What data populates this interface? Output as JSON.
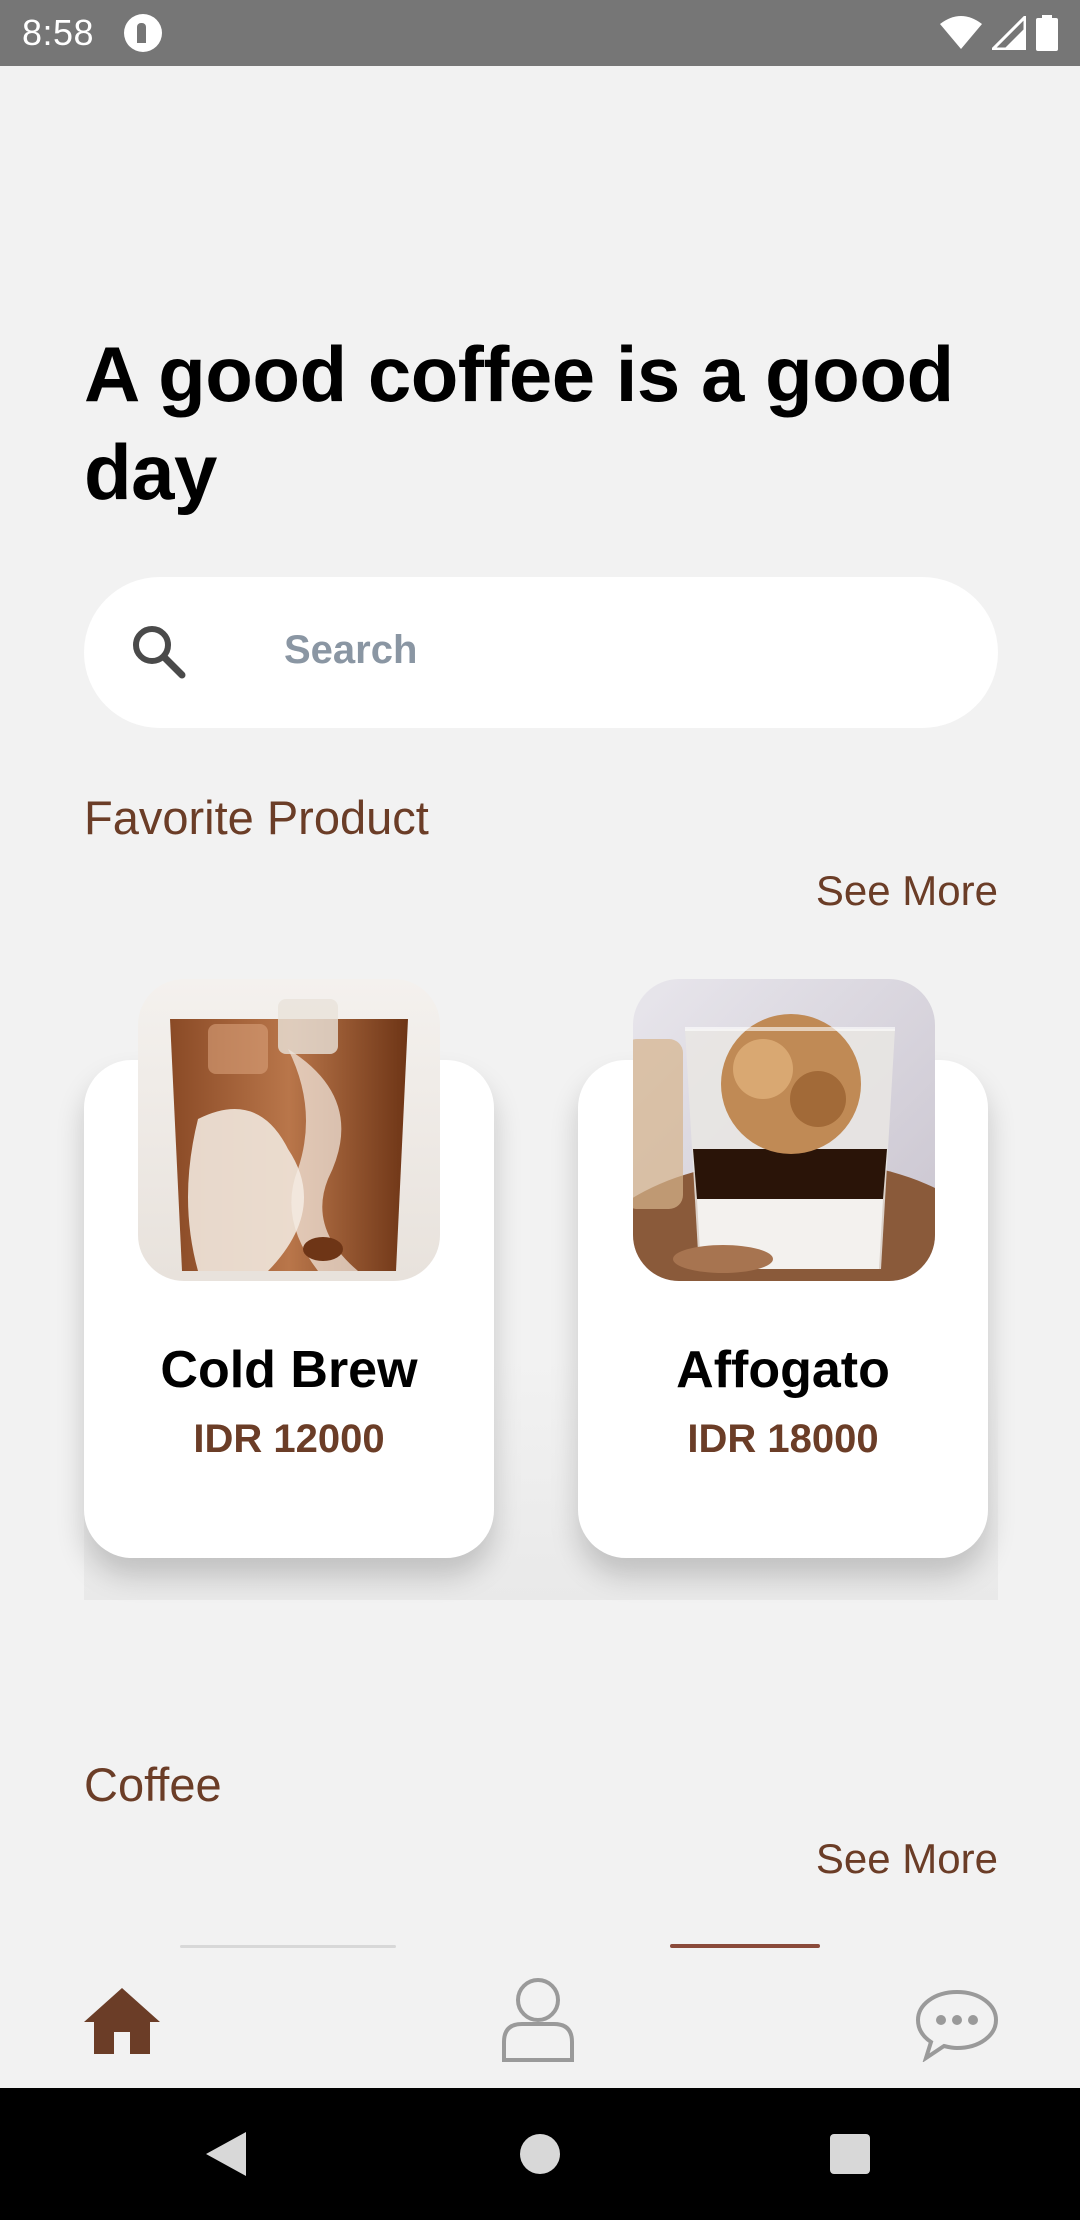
{
  "status_bar": {
    "time": "8:58"
  },
  "headline": "A good coffee is a good day",
  "search": {
    "placeholder": "Search"
  },
  "favorite_section": {
    "title": "Favorite Product",
    "see_more": "See More",
    "products": [
      {
        "name": "Cold Brew",
        "price": "IDR 12000"
      },
      {
        "name": "Affogato",
        "price": "IDR 18000"
      }
    ]
  },
  "coffee_section": {
    "title": "Coffee",
    "see_more": "See More"
  },
  "bottom_nav": {
    "items": [
      "home-icon",
      "profile-icon",
      "chat-icon"
    ],
    "active": "home-icon"
  },
  "colors": {
    "accent": "#6b3d27",
    "background": "#f2f2f2",
    "status_bar": "#767676",
    "placeholder": "#8a96a3",
    "inactive_icon": "#9a9a9a"
  }
}
